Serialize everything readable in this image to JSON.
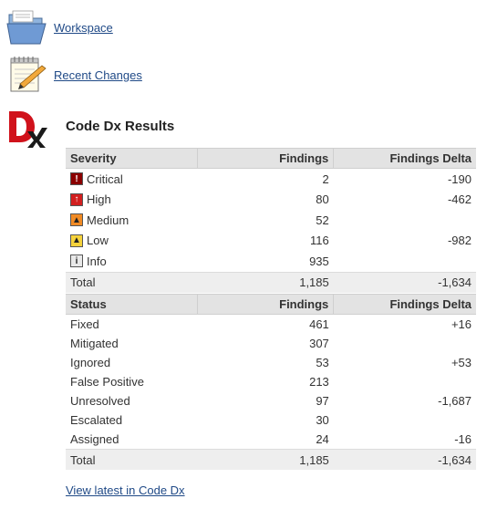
{
  "nav": {
    "workspace_label": "Workspace",
    "recent_changes_label": "Recent Changes"
  },
  "codedx": {
    "logo_text": "Dx",
    "title": "Code Dx Results",
    "view_latest_label": "View latest in Code Dx"
  },
  "severity_table": {
    "headers": [
      "Severity",
      "Findings",
      "Findings Delta"
    ],
    "rows": [
      {
        "label": "Critical",
        "icon": "critical-icon",
        "color": "#8b0000",
        "findings": "2",
        "delta": "-190"
      },
      {
        "label": "High",
        "icon": "high-icon",
        "color": "#d21f1f",
        "findings": "80",
        "delta": "-462"
      },
      {
        "label": "Medium",
        "icon": "medium-icon",
        "color": "#f08a24",
        "findings": "52",
        "delta": ""
      },
      {
        "label": "Low",
        "icon": "low-icon",
        "color": "#f5d23c",
        "findings": "116",
        "delta": "-982"
      },
      {
        "label": "Info",
        "icon": "info-icon",
        "color": "#e8e8e8",
        "findings": "935",
        "delta": ""
      }
    ],
    "total": {
      "label": "Total",
      "findings": "1,185",
      "delta": "-1,634"
    }
  },
  "status_table": {
    "headers": [
      "Status",
      "Findings",
      "Findings Delta"
    ],
    "rows": [
      {
        "label": "Fixed",
        "findings": "461",
        "delta": "+16"
      },
      {
        "label": "Mitigated",
        "findings": "307",
        "delta": ""
      },
      {
        "label": "Ignored",
        "findings": "53",
        "delta": "+53"
      },
      {
        "label": "False Positive",
        "findings": "213",
        "delta": ""
      },
      {
        "label": "Unresolved",
        "findings": "97",
        "delta": "-1,687"
      },
      {
        "label": "Escalated",
        "findings": "30",
        "delta": ""
      },
      {
        "label": "Assigned",
        "findings": "24",
        "delta": "-16"
      }
    ],
    "total": {
      "label": "Total",
      "findings": "1,185",
      "delta": "-1,634"
    }
  }
}
